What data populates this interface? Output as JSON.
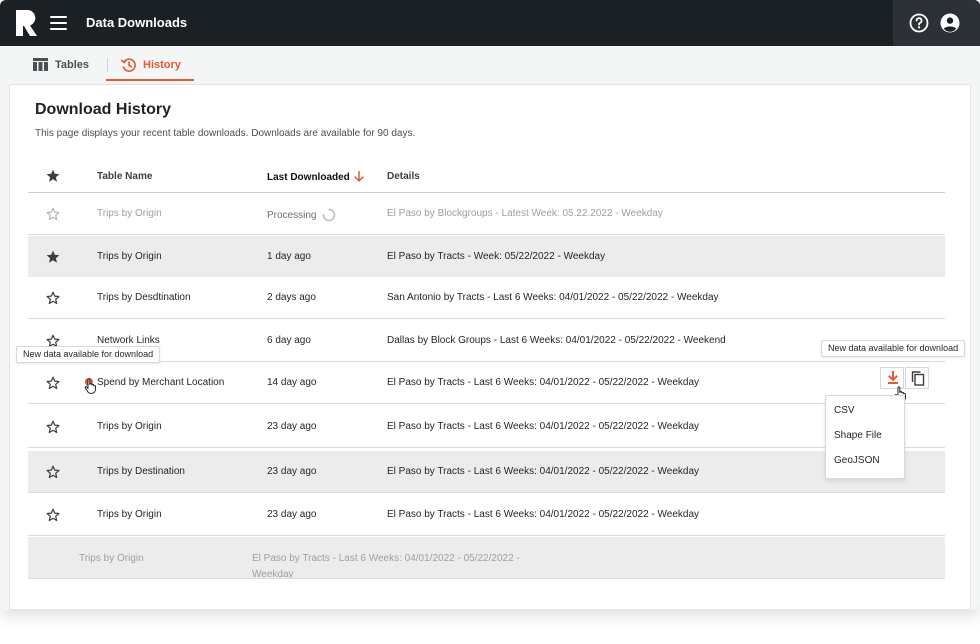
{
  "app": {
    "title": "Data Downloads",
    "logo_icon": "r-logo-icon",
    "colors": {
      "topbar": "#1b2024",
      "accent": "#e35a34"
    }
  },
  "tabs": [
    {
      "label": "Tables",
      "icon": "table-icon",
      "active": false
    },
    {
      "label": "History",
      "icon": "history-icon",
      "active": true
    }
  ],
  "page": {
    "title": "Download History",
    "subtitle": "This page displays your recent table downloads. Downloads are available for 90 days."
  },
  "table": {
    "columns": [
      "Table Name",
      "Last Downloaded",
      "Details"
    ],
    "sort": {
      "column": "Last Downloaded",
      "direction": "descending"
    },
    "rows": [
      {
        "starred": false,
        "name": "Trips by Origin",
        "date": "Processing",
        "details": "El Paso by Blockgroups - Latest Week: 05.22.2022 - Weekday",
        "status": "processing"
      },
      {
        "starred": true,
        "name": "Trips by Origin",
        "date": "1 day ago",
        "details": "El Paso by Tracts - Week: 05/22/2022 - Weekday"
      },
      {
        "starred": false,
        "name": "Trips by Desdtination",
        "date": "2 days ago",
        "details": "San Antonio by Tracts - Last 6 Weeks: 04/01/2022 - 05/22/2022 - Weekday"
      },
      {
        "starred": false,
        "name": "Network Links",
        "date": "6 day ago",
        "details": "Dallas by Block Groups - Last 6 Weeks: 04/01/2022 - 05/22/2022 - Weekend"
      },
      {
        "starred": false,
        "name": "Spend by Merchant Location",
        "date": "14 day ago",
        "details": "El Paso by Tracts - Last 6 Weeks: 04/01/2022 - 05/22/2022 - Weekday",
        "new_data": true
      },
      {
        "starred": false,
        "name": "Trips by Origin",
        "date": "23 day ago",
        "details": "El Paso by Tracts - Last 6 Weeks: 04/01/2022 - 05/22/2022 - Weekday"
      },
      {
        "starred": false,
        "name": "Trips by Destination",
        "date": "23 day ago",
        "details": "El Paso by Tracts - Last 6 Weeks: 04/01/2022 - 05/22/2022 - Weekday"
      },
      {
        "starred": false,
        "name": "Trips by Origin",
        "date": "23 day ago",
        "details": "El Paso by Tracts - Last 6 Weeks: 04/01/2022 - 05/22/2022 - Weekday"
      }
    ],
    "partial_row": {
      "name": "Trips by Origin",
      "details": "El Paso by Tracts - Last 6 Weeks: 04/01/2022 - 05/22/2022 - Weekday"
    }
  },
  "tooltips": {
    "new_data": "New data available for download"
  },
  "download_menu": {
    "options": [
      "CSV",
      "Shape File",
      "GeoJSON"
    ]
  }
}
